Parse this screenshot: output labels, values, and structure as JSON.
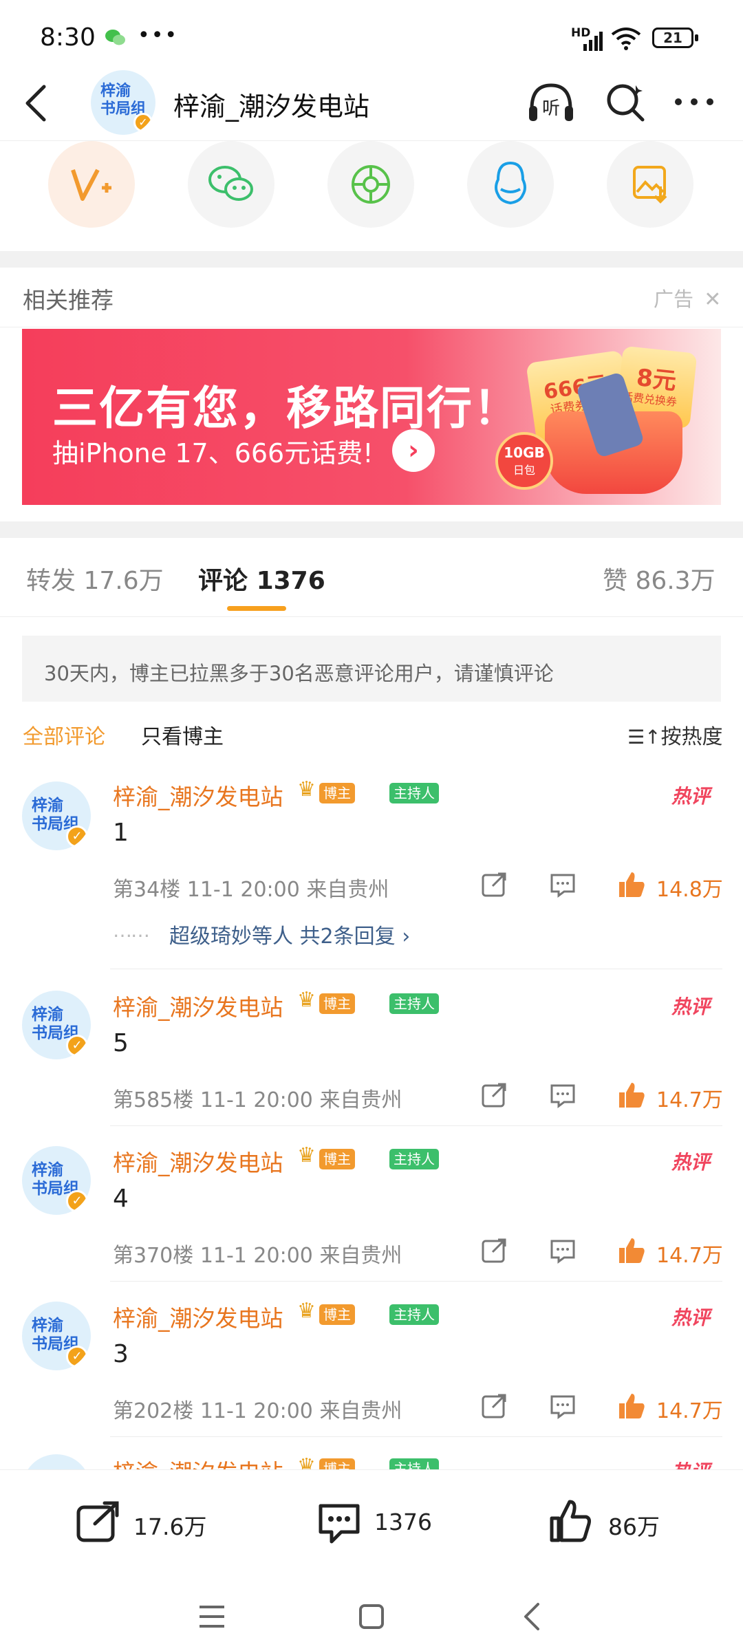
{
  "status_bar": {
    "time": "8:30",
    "dots": "•••",
    "network": "HD",
    "battery": "21"
  },
  "header": {
    "account_name": "梓渝_潮汐发电站",
    "avatar_text": "梓渝\n书局组",
    "icons": [
      "back-icon",
      "listen-icon",
      "search-icon",
      "more-icon"
    ]
  },
  "share_icons": [
    "vplus-icon",
    "wechat-icon",
    "moments-icon",
    "qq-icon",
    "save-image-icon"
  ],
  "recommend": {
    "label": "相关推荐",
    "ad_label": "广告"
  },
  "banner": {
    "headline": "三亿有您，移路同行！",
    "subline": "抽iPhone 17、666元话费!",
    "tag1": "666元",
    "tag1_sub": "话费券",
    "tag2": "8元",
    "tag2_sub": "话费兑换券",
    "tag3": "10GB",
    "tag3_sub": "日包"
  },
  "tabs": [
    {
      "label": "转发",
      "count": "17.6万"
    },
    {
      "label": "评论",
      "count": "1376"
    },
    {
      "label": "赞",
      "count": "86.3万"
    }
  ],
  "notice": "30天内，博主已拉黑多于30名恶意评论用户，请谨慎评论",
  "filters": {
    "all": "全部评论",
    "owner_only": "只看博主",
    "sort": "按热度"
  },
  "comments": [
    {
      "name": "梓渝_潮汐发电站",
      "badge_owner": "博主",
      "badge_host": "主持人",
      "hot": "热评",
      "text": "1",
      "floor": "第34楼",
      "time": "11-1 20:00",
      "location": "来自贵州",
      "likes": "14.8万",
      "replies_who": "超级琦妙等人",
      "replies_count": "共2条回复"
    },
    {
      "name": "梓渝_潮汐发电站",
      "badge_owner": "博主",
      "badge_host": "主持人",
      "hot": "热评",
      "text": "5",
      "floor": "第585楼",
      "time": "11-1 20:00",
      "location": "来自贵州",
      "likes": "14.7万"
    },
    {
      "name": "梓渝_潮汐发电站",
      "badge_owner": "博主",
      "badge_host": "主持人",
      "hot": "热评",
      "text": "4",
      "floor": "第370楼",
      "time": "11-1 20:00",
      "location": "来自贵州",
      "likes": "14.7万"
    },
    {
      "name": "梓渝_潮汐发电站",
      "badge_owner": "博主",
      "badge_host": "主持人",
      "hot": "热评",
      "text": "3",
      "floor": "第202楼",
      "time": "11-1 20:00",
      "location": "来自贵州",
      "likes": "14.7万"
    },
    {
      "name": "梓渝_潮汐发电站",
      "badge_owner": "博主",
      "badge_host": "主持人",
      "hot": "热评"
    }
  ],
  "bottom_bar": {
    "repost": "17.6万",
    "comment": "1376",
    "like": "86万"
  },
  "colors": {
    "accent": "#f7a01e",
    "name": "#e8761f",
    "hot": "#f0455e",
    "banner": "#f53e5b"
  }
}
